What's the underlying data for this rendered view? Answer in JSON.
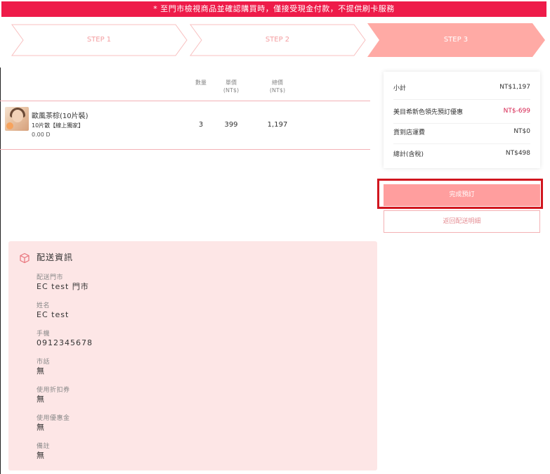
{
  "banner": {
    "text": "* 至門市檢視商品並確認購買時，僅接受現金付款，不提供刷卡服務"
  },
  "steps": [
    {
      "label": "STEP 1",
      "active": false
    },
    {
      "label": "STEP 2",
      "active": false
    },
    {
      "label": "STEP 3",
      "active": true
    }
  ],
  "colors": {
    "accent": "#ee1b49",
    "step_active": "#ffaaa5",
    "step_border": "#f8c0c0",
    "panel_bg": "#fde6e6"
  },
  "table": {
    "headers": {
      "qty": "數量",
      "unit": "單價",
      "unit_currency": "(NT$)",
      "total": "總價",
      "total_currency": "(NT$)"
    },
    "rows": [
      {
        "name": "歐風茶棕(10片裝)",
        "spec": "10片散【線上獨家】",
        "degree": "0.00 D",
        "qty": "3",
        "unit": "399",
        "total": "1,197"
      }
    ]
  },
  "summary": {
    "subtotal_label": "小計",
    "subtotal_value": "NT$1,197",
    "discount_label": "美目希新色領先預訂優惠",
    "discount_value": "NT$-699",
    "shipping_label": "貨到店運費",
    "shipping_value": "NT$0",
    "total_label": "總計(含稅)",
    "total_value": "NT$498"
  },
  "buttons": {
    "complete": "完成預訂",
    "back": "返回配送明細"
  },
  "shipping_info": {
    "icon": "box-icon",
    "title": "配送資訊",
    "fields": [
      {
        "label": "配送門市",
        "value": "EC test 門市"
      },
      {
        "label": "姓名",
        "value": "EC test"
      },
      {
        "label": "手機",
        "value": "0912345678"
      },
      {
        "label": "市話",
        "value": "無"
      },
      {
        "label": "使用折扣券",
        "value": "無"
      },
      {
        "label": "使用優惠金",
        "value": "無"
      },
      {
        "label": "備註",
        "value": "無"
      }
    ]
  }
}
